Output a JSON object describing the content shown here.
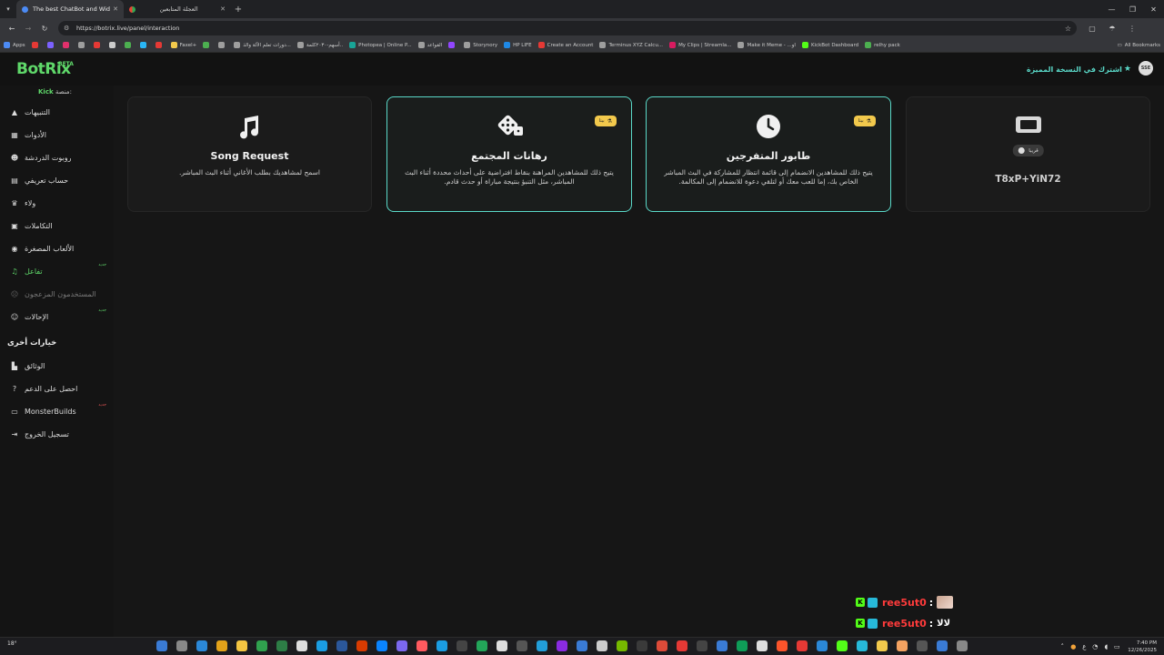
{
  "browser": {
    "tabs": [
      {
        "title": "The best ChatBot and Widgets",
        "active": true
      },
      {
        "title": "العجلة المتابعين",
        "active": false
      }
    ],
    "url": "https://botrix.live/panel/interaction",
    "bookmarks": [
      {
        "label": "Apps",
        "color": "#4c8bf5"
      },
      {
        "label": "",
        "color": "#e53935"
      },
      {
        "label": "",
        "color": "#7b61ff"
      },
      {
        "label": "",
        "color": "#e1306c"
      },
      {
        "label": "",
        "color": "#9e9e9e"
      },
      {
        "label": "",
        "color": "#e53935"
      },
      {
        "label": "",
        "color": "#ccc"
      },
      {
        "label": "",
        "color": "#4caf50"
      },
      {
        "label": "",
        "color": "#29b6f6"
      },
      {
        "label": "",
        "color": "#e53935"
      },
      {
        "label": "Faxel+",
        "color": "#f2c94c"
      },
      {
        "label": "",
        "color": "#4caf50"
      },
      {
        "label": "",
        "color": "#9e9e9e"
      },
      {
        "label": "دورات تعلم الآلة والذ...",
        "color": "#9e9e9e"
      },
      {
        "label": "أسهم-٢٠٣٠كلمة..",
        "color": "#9e9e9e"
      },
      {
        "label": "Photopea | Online P...",
        "color": "#18a497"
      },
      {
        "label": "القواعد",
        "color": "#9e9e9e"
      },
      {
        "label": "",
        "color": "#9146ff"
      },
      {
        "label": "Storynory",
        "color": "#9e9e9e"
      },
      {
        "label": "HP LIFE",
        "color": "#1e88e5"
      },
      {
        "label": "Create an Account",
        "color": "#e53935"
      },
      {
        "label": "Terminus XYZ Calcu...",
        "color": "#9e9e9e"
      },
      {
        "label": "My Clips | Streamla...",
        "color": "#d81b60"
      },
      {
        "label": "Make it Meme - ...او",
        "color": "#9e9e9e"
      },
      {
        "label": "KickBot Dashboard",
        "color": "#53fc18"
      },
      {
        "label": "relhy pack",
        "color": "#4caf50"
      }
    ],
    "all_bookmarks": "All Bookmarks"
  },
  "header": {
    "logo": "BotRix",
    "logo_beta": "BETA",
    "premium_link": "اشترك في النسخة المميزة",
    "avatar_text": "SSE"
  },
  "sidebar": {
    "platform_label": "منصة:",
    "platform_value": "Kick",
    "items": [
      {
        "label": "التنبيهات",
        "icon": "warning-icon",
        "glyph": "▲",
        "state": ""
      },
      {
        "label": "الأدوات",
        "icon": "widgets-icon",
        "glyph": "▦",
        "state": ""
      },
      {
        "label": "روبوت الدردشة",
        "icon": "robot-icon",
        "glyph": "☻",
        "state": ""
      },
      {
        "label": "حساب تعريفي",
        "icon": "id-card-icon",
        "glyph": "▤",
        "state": ""
      },
      {
        "label": "ولاء",
        "icon": "trophy-icon",
        "glyph": "♛",
        "state": ""
      },
      {
        "label": "التكاملات",
        "icon": "puzzle-icon",
        "glyph": "▣",
        "state": ""
      },
      {
        "label": "الألعاب المصغرة",
        "icon": "gamepad-icon",
        "glyph": "◉",
        "state": ""
      },
      {
        "label": "تفاعل",
        "icon": "music-icon",
        "glyph": "♫",
        "state": "active",
        "badge": "جديد"
      },
      {
        "label": "المستخدمون المزعجون",
        "icon": "ban-user-icon",
        "glyph": "☹",
        "state": "disabled"
      },
      {
        "label": "الإحالات",
        "icon": "users-icon",
        "glyph": "☺",
        "state": "",
        "badge": "جديد"
      }
    ],
    "other_title": "خيارات أخرى",
    "other_items": [
      {
        "label": "الوثائق",
        "icon": "book-icon",
        "glyph": "▙"
      },
      {
        "label": "احصل على الدعم",
        "icon": "help-icon",
        "glyph": "?"
      },
      {
        "label": "MonsterBuilds",
        "icon": "monitor-icon",
        "glyph": "▭",
        "badge": "جديد"
      },
      {
        "label": "تسجيل الخروج",
        "icon": "logout-icon",
        "glyph": "⇥"
      }
    ]
  },
  "cards": [
    {
      "id": "song-request",
      "title": "Song Request",
      "description": "اسمح لمشاهديك بطلب الأغاني أثناء البث المباشر.",
      "icon": "music-note-icon"
    },
    {
      "id": "community-bets",
      "title": "رهانات المجتمع",
      "description": "يتيح ذلك للمشاهدين المراهنة بنقاط افتراضية على أحداث محددة أثناء البث المباشر، مثل التنبؤ بنتيجة مباراة أو حدث قادم.",
      "icon": "dice-icon",
      "badge": "بيتا"
    },
    {
      "id": "viewer-queue",
      "title": "طابور المتفرجين",
      "description": "يتيح ذلك للمشاهدين الانضمام إلى قائمة انتظار للمشاركة في البث المباشر الخاص بك، إما للعب معك أو لتلقي دعوة للانضمام إلى المكالمة.",
      "icon": "clock-icon",
      "badge": "بيتا"
    },
    {
      "id": "coming-soon",
      "title": "T8xP+YiN72",
      "soon_label": "قريبا",
      "icon": "ticket-icon"
    }
  ],
  "chat_overlay": [
    {
      "user": "ree5ut0",
      "message": "",
      "emote": true
    },
    {
      "user": "ree5ut0",
      "message": "لالا",
      "emote": false
    }
  ],
  "taskbar": {
    "weather": "18°",
    "time": "7:40 PM",
    "date": "12/26/2025",
    "language": "ع",
    "app_colors": [
      "#3a7bd5",
      "#888",
      "#2b88d8",
      "#e3a21a",
      "#f4c542",
      "#30a14e",
      "#2d7d46",
      "#ddd",
      "#1b9de2",
      "#2b579a",
      "#d83b01",
      "#0a84ff",
      "#7b68ee",
      "#ff5a5f",
      "#1b9de2",
      "#444",
      "#23a559",
      "#ddd",
      "#555",
      "#229ed9",
      "#8a2be2",
      "#3a7bd5",
      "#ccc",
      "#76b900",
      "#3a3a3a",
      "#dd4b39",
      "#e53935",
      "#444",
      "#3a7bd5",
      "#0f9d58",
      "#ddd",
      "#fb542b",
      "#e53935",
      "#2b88d8",
      "#53fc18",
      "#27b9d9",
      "#f2c94c",
      "#f4a261",
      "#555",
      "#3a7bd5",
      "#888"
    ]
  }
}
